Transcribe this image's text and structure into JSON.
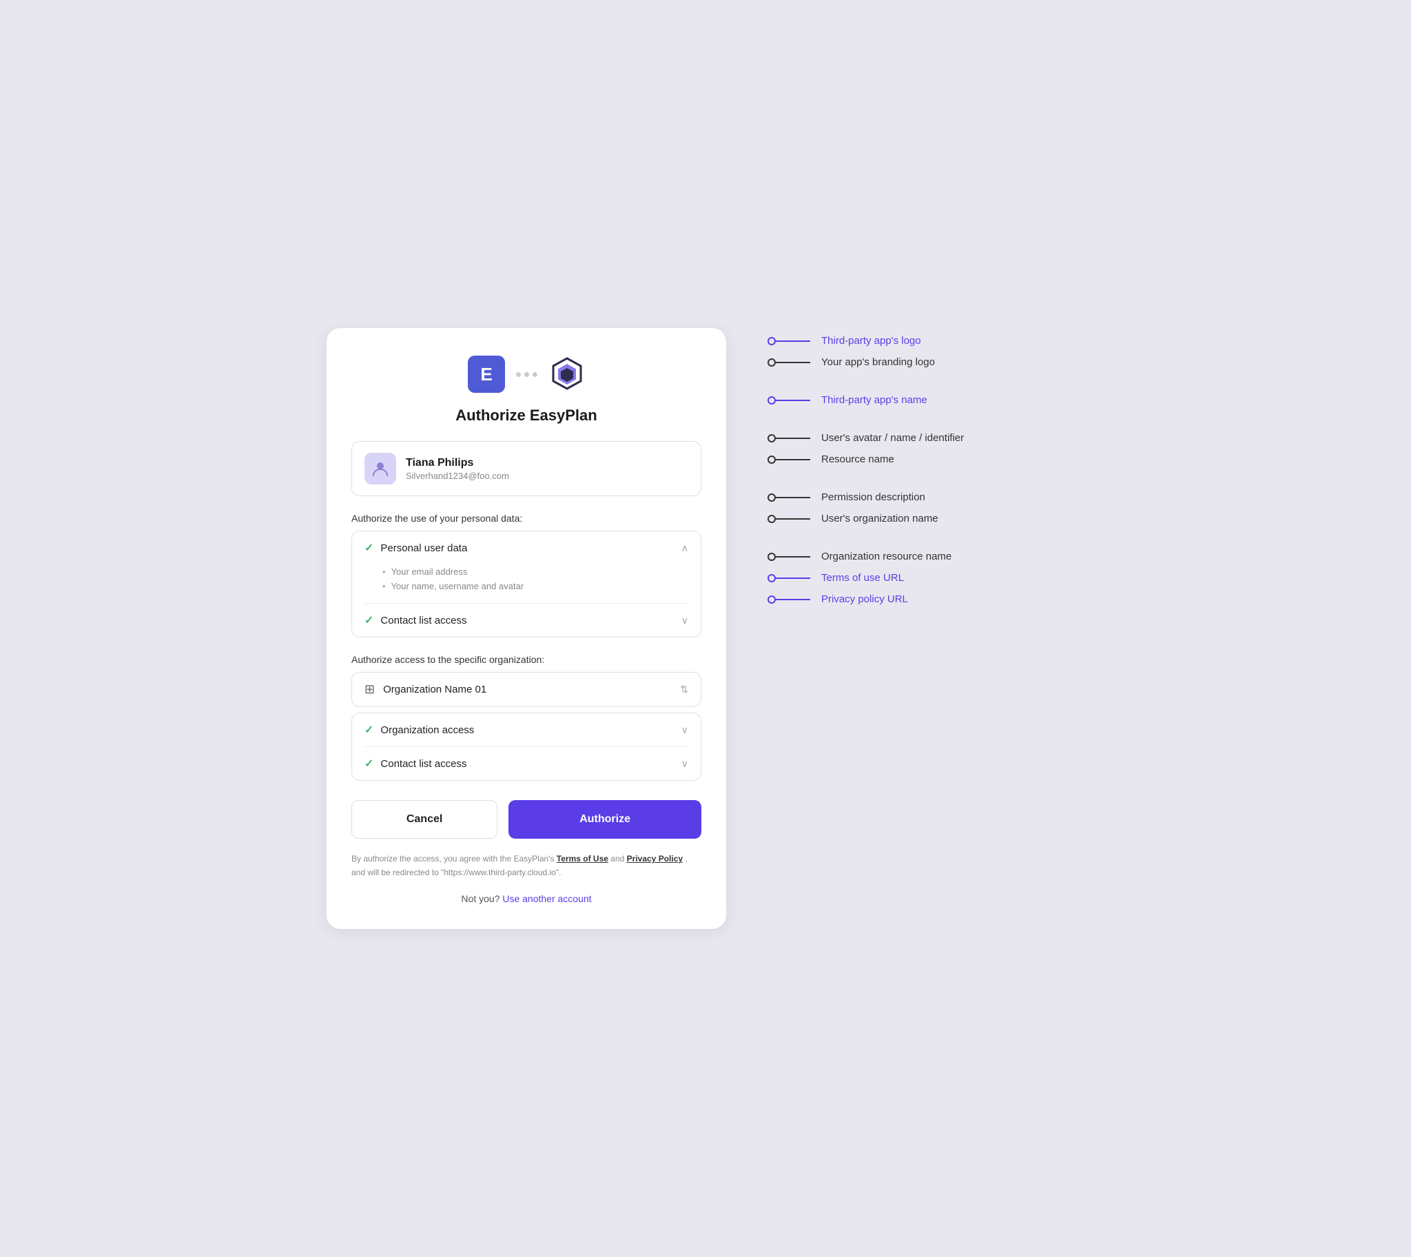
{
  "card": {
    "title": "Authorize EasyPlan",
    "user": {
      "name": "Tiana Philips",
      "email": "Silverhand1234@foo.com"
    },
    "personal_data_label": "Authorize the use of your personal data:",
    "permissions": [
      {
        "name": "Personal user data",
        "expanded": true,
        "details": [
          "Your email address",
          "Your name, username and avatar"
        ]
      },
      {
        "name": "Contact list access",
        "expanded": false,
        "details": []
      }
    ],
    "org_label": "Authorize access to the specific organization:",
    "org_name": "Organization Name 01",
    "org_permissions": [
      {
        "name": "Organization access",
        "expanded": false
      },
      {
        "name": "Contact list access",
        "expanded": false
      }
    ],
    "cancel_label": "Cancel",
    "authorize_label": "Authorize",
    "legal_text_prefix": "By authorize the access, you agree with the EasyPlan's",
    "terms_label": "Terms of Use",
    "legal_text_middle": "and",
    "privacy_label": "Privacy Policy",
    "legal_text_suffix": ", and will be redirected to \"https://www.third-party.cloud.io\".",
    "not_you_text": "Not you?",
    "use_another_label": "Use another account"
  },
  "annotations": [
    {
      "text": "Third-party app's logo",
      "style": "purple",
      "spacer": false
    },
    {
      "text": "Your app's branding logo",
      "style": "dark",
      "spacer": false
    },
    {
      "text": "Third-party app's name",
      "style": "purple",
      "spacer": true
    },
    {
      "text": "User's avatar / name / identifier",
      "style": "dark",
      "spacer": true
    },
    {
      "text": "Resource name",
      "style": "dark",
      "spacer": false
    },
    {
      "text": "Permission description",
      "style": "dark",
      "spacer": true
    },
    {
      "text": "User's organization name",
      "style": "dark",
      "spacer": false
    },
    {
      "text": "Organization resource name",
      "style": "dark",
      "spacer": true
    },
    {
      "text": "Terms of use URL",
      "style": "purple",
      "spacer": false
    },
    {
      "text": "Privacy policy URL",
      "style": "purple",
      "spacer": false
    }
  ]
}
